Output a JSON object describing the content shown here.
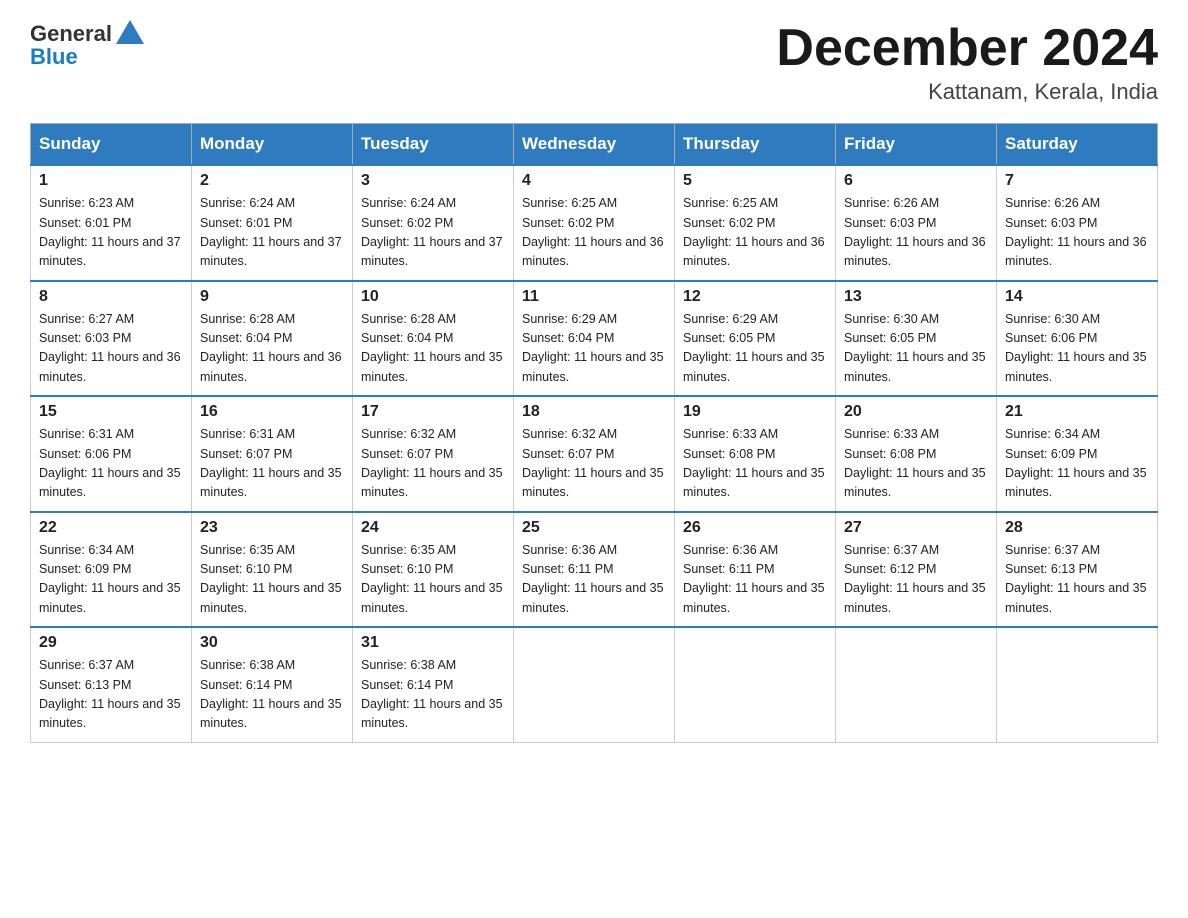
{
  "header": {
    "logo_text_general": "General",
    "logo_text_blue": "Blue",
    "month_title": "December 2024",
    "location": "Kattanam, Kerala, India"
  },
  "weekdays": [
    "Sunday",
    "Monday",
    "Tuesday",
    "Wednesday",
    "Thursday",
    "Friday",
    "Saturday"
  ],
  "weeks": [
    [
      {
        "day": "1",
        "sunrise": "6:23 AM",
        "sunset": "6:01 PM",
        "daylight": "11 hours and 37 minutes."
      },
      {
        "day": "2",
        "sunrise": "6:24 AM",
        "sunset": "6:01 PM",
        "daylight": "11 hours and 37 minutes."
      },
      {
        "day": "3",
        "sunrise": "6:24 AM",
        "sunset": "6:02 PM",
        "daylight": "11 hours and 37 minutes."
      },
      {
        "day": "4",
        "sunrise": "6:25 AM",
        "sunset": "6:02 PM",
        "daylight": "11 hours and 36 minutes."
      },
      {
        "day": "5",
        "sunrise": "6:25 AM",
        "sunset": "6:02 PM",
        "daylight": "11 hours and 36 minutes."
      },
      {
        "day": "6",
        "sunrise": "6:26 AM",
        "sunset": "6:03 PM",
        "daylight": "11 hours and 36 minutes."
      },
      {
        "day": "7",
        "sunrise": "6:26 AM",
        "sunset": "6:03 PM",
        "daylight": "11 hours and 36 minutes."
      }
    ],
    [
      {
        "day": "8",
        "sunrise": "6:27 AM",
        "sunset": "6:03 PM",
        "daylight": "11 hours and 36 minutes."
      },
      {
        "day": "9",
        "sunrise": "6:28 AM",
        "sunset": "6:04 PM",
        "daylight": "11 hours and 36 minutes."
      },
      {
        "day": "10",
        "sunrise": "6:28 AM",
        "sunset": "6:04 PM",
        "daylight": "11 hours and 35 minutes."
      },
      {
        "day": "11",
        "sunrise": "6:29 AM",
        "sunset": "6:04 PM",
        "daylight": "11 hours and 35 minutes."
      },
      {
        "day": "12",
        "sunrise": "6:29 AM",
        "sunset": "6:05 PM",
        "daylight": "11 hours and 35 minutes."
      },
      {
        "day": "13",
        "sunrise": "6:30 AM",
        "sunset": "6:05 PM",
        "daylight": "11 hours and 35 minutes."
      },
      {
        "day": "14",
        "sunrise": "6:30 AM",
        "sunset": "6:06 PM",
        "daylight": "11 hours and 35 minutes."
      }
    ],
    [
      {
        "day": "15",
        "sunrise": "6:31 AM",
        "sunset": "6:06 PM",
        "daylight": "11 hours and 35 minutes."
      },
      {
        "day": "16",
        "sunrise": "6:31 AM",
        "sunset": "6:07 PM",
        "daylight": "11 hours and 35 minutes."
      },
      {
        "day": "17",
        "sunrise": "6:32 AM",
        "sunset": "6:07 PM",
        "daylight": "11 hours and 35 minutes."
      },
      {
        "day": "18",
        "sunrise": "6:32 AM",
        "sunset": "6:07 PM",
        "daylight": "11 hours and 35 minutes."
      },
      {
        "day": "19",
        "sunrise": "6:33 AM",
        "sunset": "6:08 PM",
        "daylight": "11 hours and 35 minutes."
      },
      {
        "day": "20",
        "sunrise": "6:33 AM",
        "sunset": "6:08 PM",
        "daylight": "11 hours and 35 minutes."
      },
      {
        "day": "21",
        "sunrise": "6:34 AM",
        "sunset": "6:09 PM",
        "daylight": "11 hours and 35 minutes."
      }
    ],
    [
      {
        "day": "22",
        "sunrise": "6:34 AM",
        "sunset": "6:09 PM",
        "daylight": "11 hours and 35 minutes."
      },
      {
        "day": "23",
        "sunrise": "6:35 AM",
        "sunset": "6:10 PM",
        "daylight": "11 hours and 35 minutes."
      },
      {
        "day": "24",
        "sunrise": "6:35 AM",
        "sunset": "6:10 PM",
        "daylight": "11 hours and 35 minutes."
      },
      {
        "day": "25",
        "sunrise": "6:36 AM",
        "sunset": "6:11 PM",
        "daylight": "11 hours and 35 minutes."
      },
      {
        "day": "26",
        "sunrise": "6:36 AM",
        "sunset": "6:11 PM",
        "daylight": "11 hours and 35 minutes."
      },
      {
        "day": "27",
        "sunrise": "6:37 AM",
        "sunset": "6:12 PM",
        "daylight": "11 hours and 35 minutes."
      },
      {
        "day": "28",
        "sunrise": "6:37 AM",
        "sunset": "6:13 PM",
        "daylight": "11 hours and 35 minutes."
      }
    ],
    [
      {
        "day": "29",
        "sunrise": "6:37 AM",
        "sunset": "6:13 PM",
        "daylight": "11 hours and 35 minutes."
      },
      {
        "day": "30",
        "sunrise": "6:38 AM",
        "sunset": "6:14 PM",
        "daylight": "11 hours and 35 minutes."
      },
      {
        "day": "31",
        "sunrise": "6:38 AM",
        "sunset": "6:14 PM",
        "daylight": "11 hours and 35 minutes."
      },
      null,
      null,
      null,
      null
    ]
  ]
}
